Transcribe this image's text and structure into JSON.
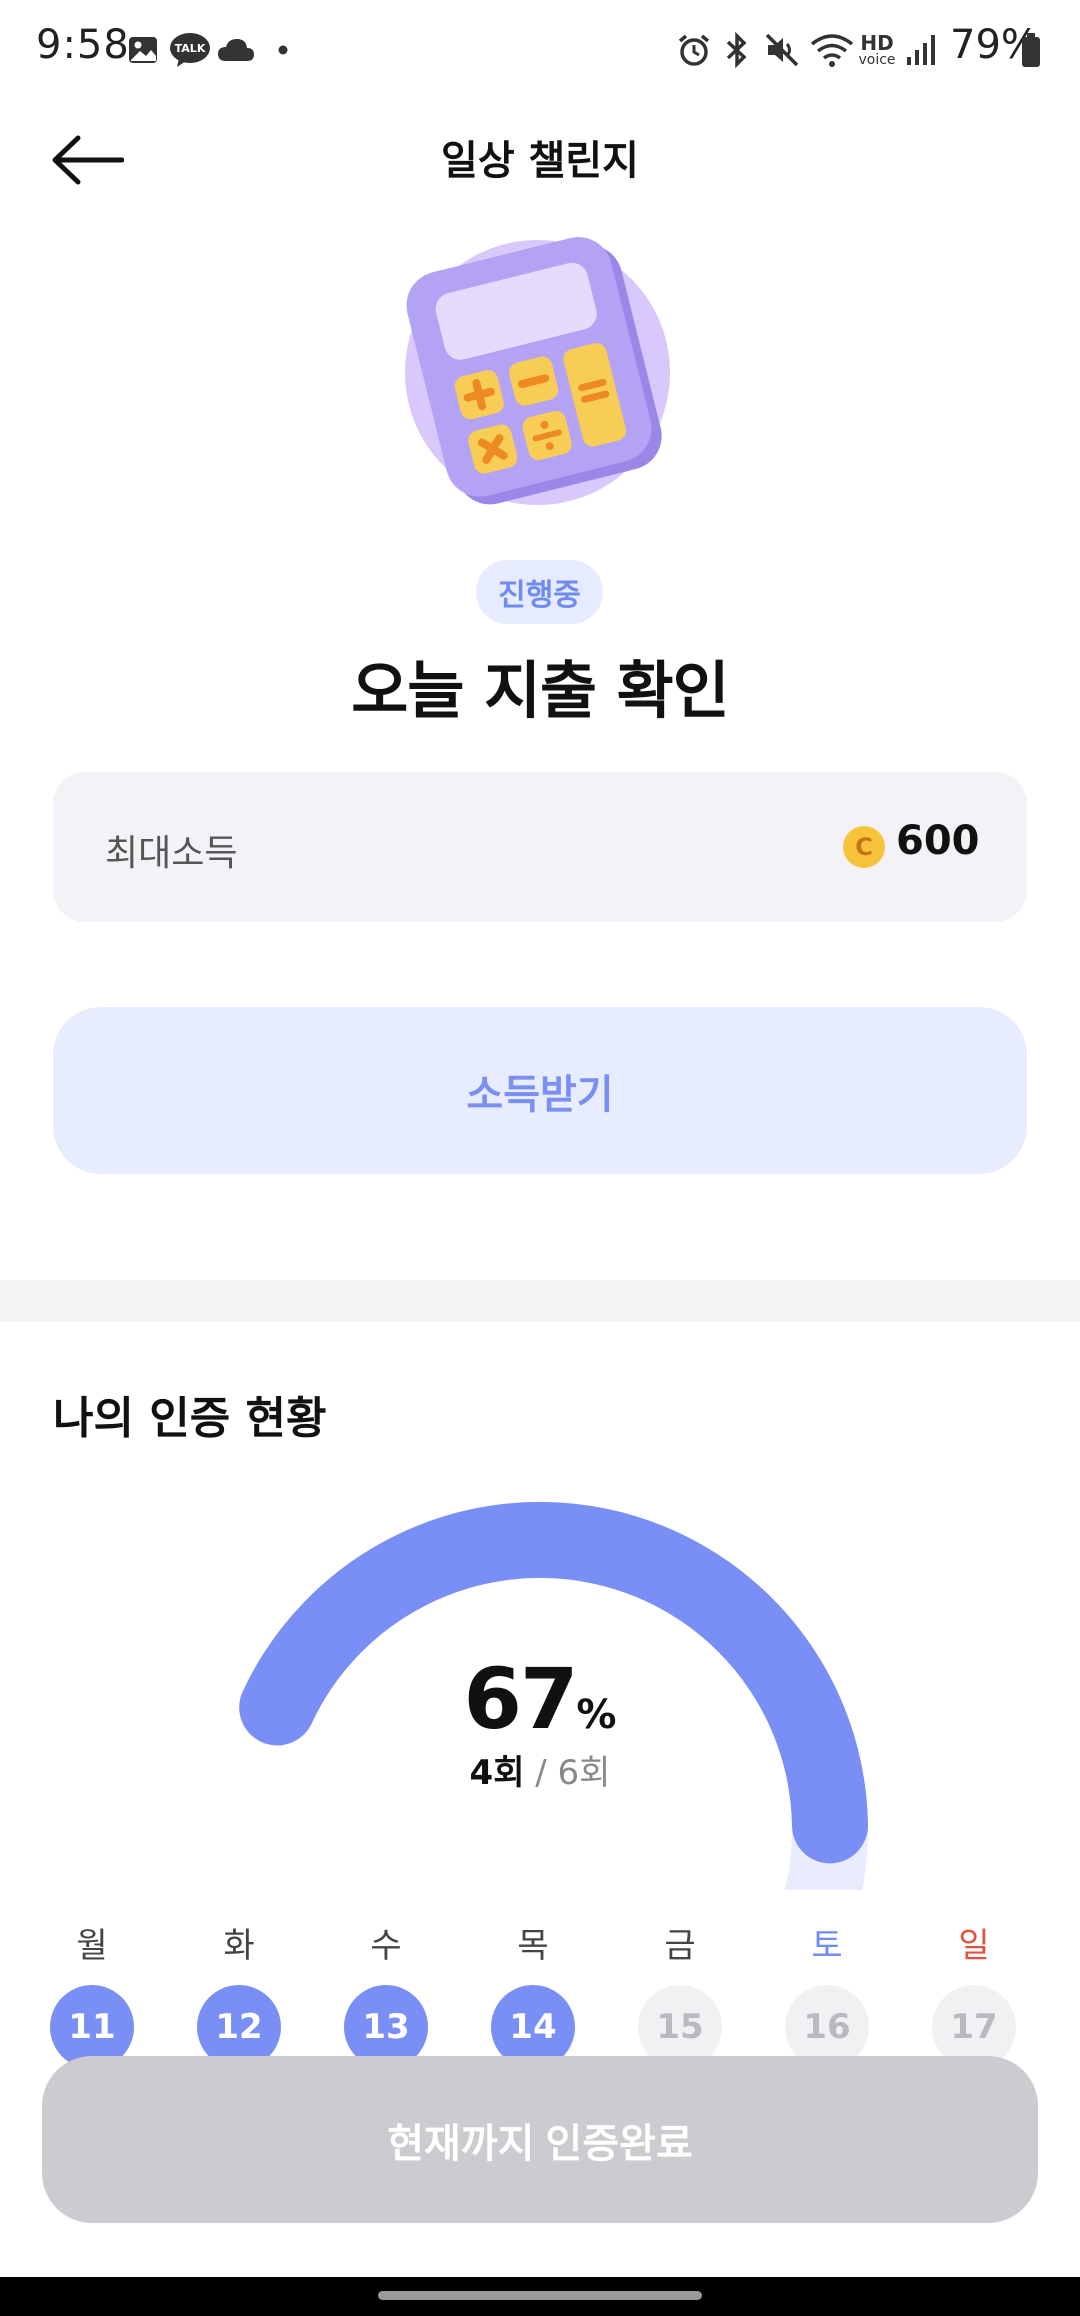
{
  "status_bar": {
    "time": "9:58",
    "battery": "79%",
    "left_icons": [
      "image-icon",
      "kakaotalk-icon",
      "cloud-icon",
      "dot-icon"
    ],
    "right_icons": [
      "alarm-icon",
      "bluetooth-icon",
      "mute-icon",
      "wifi-icon",
      "hd-voice-icon",
      "signal-icon",
      "battery-icon"
    ],
    "talk_badge": "TALK",
    "hd_label": "HD",
    "voice_label": "voice"
  },
  "header": {
    "title": "일상 챌린지"
  },
  "challenge": {
    "status_badge": "진행중",
    "title": "오늘 지출 확인"
  },
  "income": {
    "label": "최대소득",
    "coin_symbol": "C",
    "value": "600"
  },
  "claim_button": "소득받기",
  "progress_section": {
    "title": "나의 인증 현황",
    "percent": "67",
    "percent_sign": "%",
    "progress_fraction": 0.67,
    "done_count": "4회",
    "separator": " / ",
    "total_count": "6회"
  },
  "week": [
    {
      "day": "월",
      "date": "11",
      "done": true
    },
    {
      "day": "화",
      "date": "12",
      "done": true
    },
    {
      "day": "수",
      "date": "13",
      "done": true
    },
    {
      "day": "목",
      "date": "14",
      "done": true
    },
    {
      "day": "금",
      "date": "15",
      "done": false
    },
    {
      "day": "토",
      "date": "16",
      "done": false
    },
    {
      "day": "일",
      "date": "17",
      "done": false
    }
  ],
  "complete_button": "현재까지 인증완료",
  "colors": {
    "accent": "#7a8ff5",
    "gauge_track": "#e8ecfd",
    "saturday": "#6f8bf2",
    "sunday": "#e0533d"
  }
}
